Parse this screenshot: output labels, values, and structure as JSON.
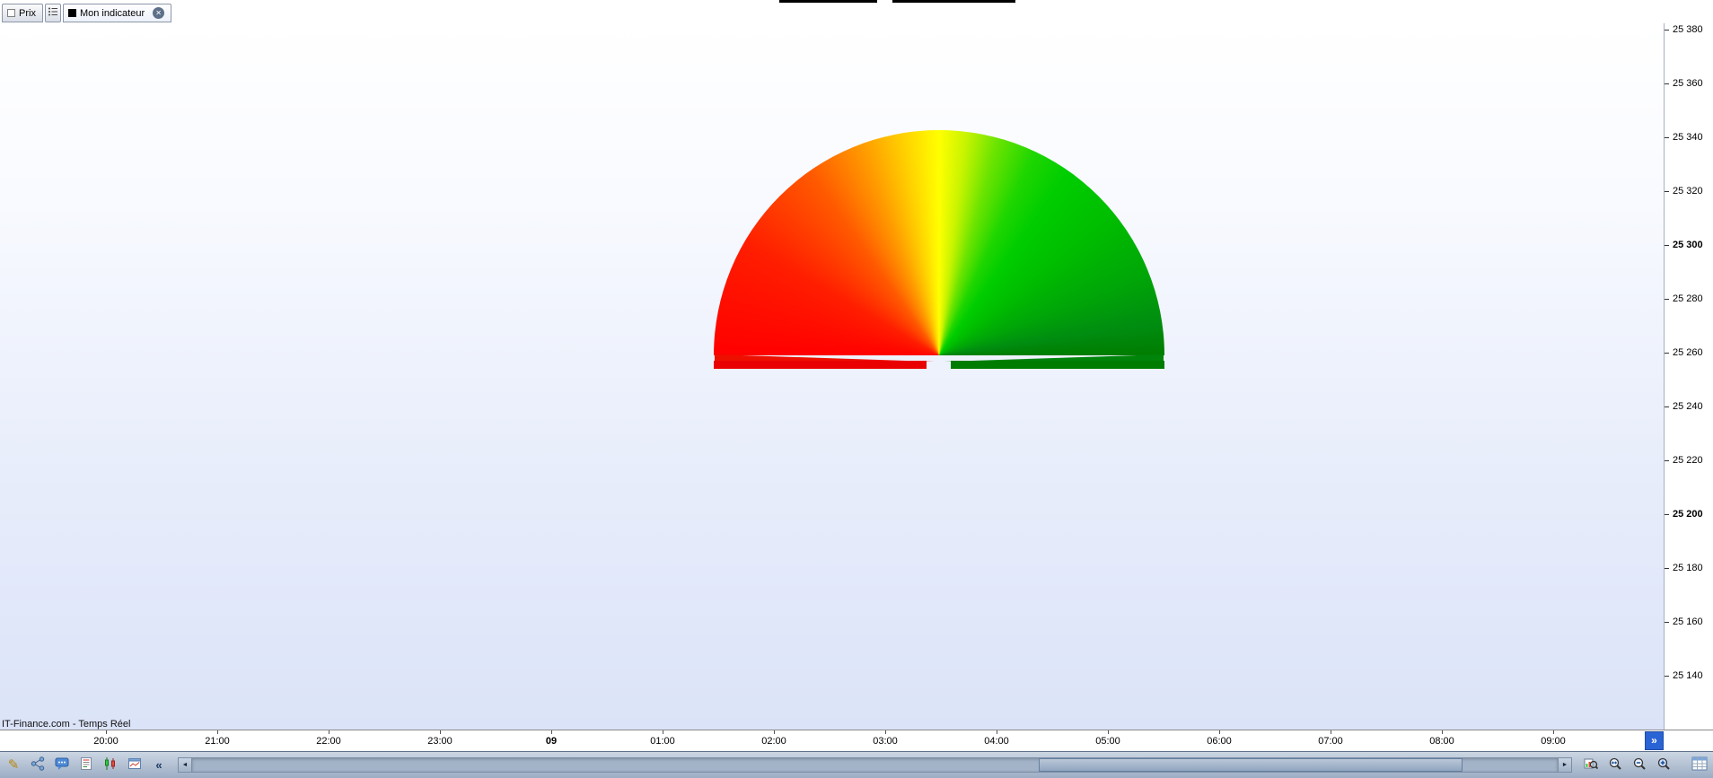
{
  "tab_bar": {
    "prix_tab": {
      "label": "Prix"
    },
    "list_button": {
      "icon": "list-icon"
    },
    "indicator_tab": {
      "label": "Mon indicateur",
      "close_glyph": "✕"
    }
  },
  "chart": {
    "watermark": "IT-Finance.com - Temps Réel",
    "gauge": {
      "type": "semicircle-gradient-gauge",
      "gradient_left_color": "#ff0000",
      "gradient_top_color": "#ffff00",
      "gradient_right_color": "#007d00",
      "left_bar_color": "#e90000",
      "right_bar_color": "#007c00"
    }
  },
  "price_axis": {
    "labels": [
      "25 380",
      "25 360",
      "25 340",
      "25 320",
      "25 300",
      "25 280",
      "25 260",
      "25 240",
      "25 220",
      "25 200",
      "25 180",
      "25 160",
      "25 140"
    ],
    "bold_labels": [
      "25 300",
      "25 200"
    ]
  },
  "time_axis": {
    "labels": [
      "20:00",
      "21:00",
      "22:00",
      "23:00",
      "09",
      "01:00",
      "02:00",
      "03:00",
      "04:00",
      "05:00",
      "06:00",
      "07:00",
      "08:00",
      "09:00"
    ],
    "bold_labels": [
      "09"
    ],
    "expand_glyph": "»"
  },
  "toolbar": {
    "pencil_glyph": "✎",
    "collapse_glyph": "«",
    "scrollbar": {
      "left_arrow": "◄",
      "right_arrow": "►"
    },
    "icons": [
      "pencil-icon",
      "share-icon",
      "chat-icon",
      "news-icon",
      "candlestick-chart-icon",
      "line-chart-icon",
      "collapse-icon",
      "scroll-left-icon",
      "scroll-right-icon",
      "chart-zoom-icon",
      "fit-scale-icon",
      "zoom-out-icon",
      "zoom-in-icon",
      "data-grid-icon"
    ]
  }
}
